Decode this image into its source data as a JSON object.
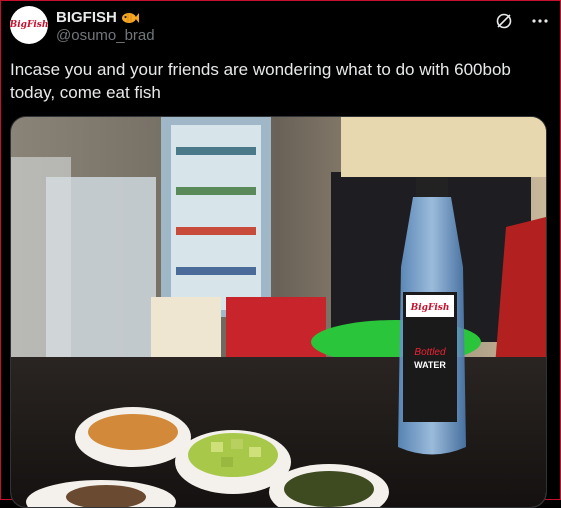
{
  "author": {
    "display_name": "BIGFISH",
    "handle": "@osumo_brad",
    "avatar_text": "BigFish",
    "badge_icon": "fish-emoji-icon"
  },
  "header_actions": [
    {
      "name": "grok-icon"
    },
    {
      "name": "more-icon"
    }
  ],
  "post": {
    "text": "Incase you and your friends are wondering what to do with 600bob today, come eat fish"
  },
  "media": {
    "bottle_label_brand": "BigFish",
    "bottle_label_line1": "Bottled",
    "bottle_label_line2": "WATER",
    "colors": {
      "frame_border": "#c8102e",
      "fish_badge": "#f5a623"
    }
  }
}
